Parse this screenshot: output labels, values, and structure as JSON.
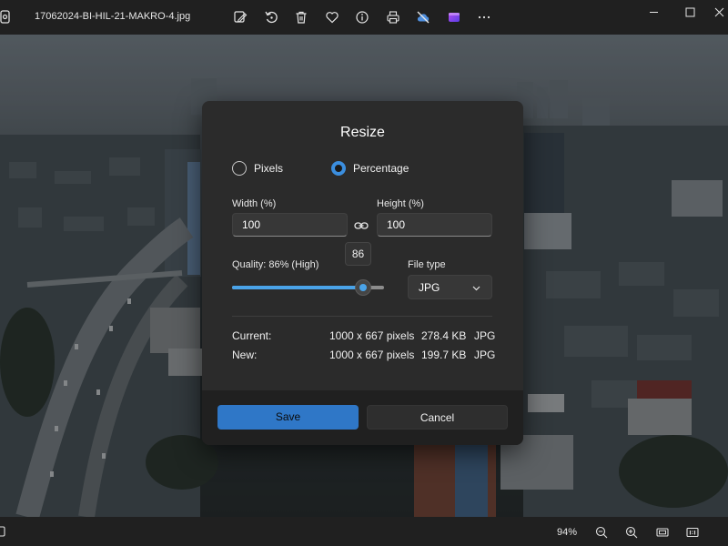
{
  "titlebar": {
    "filename": "17062024-BI-HIL-21-MAKRO-4.jpg",
    "tools": [
      "edit-icon",
      "rotate-icon",
      "delete-icon",
      "favorite-icon",
      "info-icon",
      "print-icon",
      "cloud-off-icon",
      "clipchamp-icon",
      "more-icon"
    ],
    "window_controls": [
      "minimize-icon",
      "maximize-icon",
      "close-icon"
    ]
  },
  "dialog": {
    "title": "Resize",
    "mode_options": [
      {
        "label": "Pixels",
        "selected": false
      },
      {
        "label": "Percentage",
        "selected": true
      }
    ],
    "width_label": "Width  (%)",
    "width_value": "100",
    "height_label": "Height  (%)",
    "height_value": "100",
    "quality_label": "Quality: 86% (High)",
    "quality_value": 86,
    "quality_tooltip": "86",
    "filetype_label": "File type",
    "filetype_value": "JPG",
    "current_label": "Current:",
    "current_dims": "1000 x 667 pixels",
    "current_size": "278.4 KB",
    "current_format": "JPG",
    "new_label": "New:",
    "new_dims": "1000 x 667 pixels",
    "new_size": "199.7 KB",
    "new_format": "JPG",
    "save_label": "Save",
    "cancel_label": "Cancel"
  },
  "statusbar": {
    "zoom": "94%",
    "icons": [
      "zoom-out-icon",
      "zoom-in-icon",
      "fit-window-icon",
      "actual-size-icon"
    ]
  },
  "colors": {
    "accent": "#2f77c7",
    "slider_fill": "#4aa3e8",
    "dialog_bg": "#2b2b2b",
    "app_bg": "#202020"
  }
}
